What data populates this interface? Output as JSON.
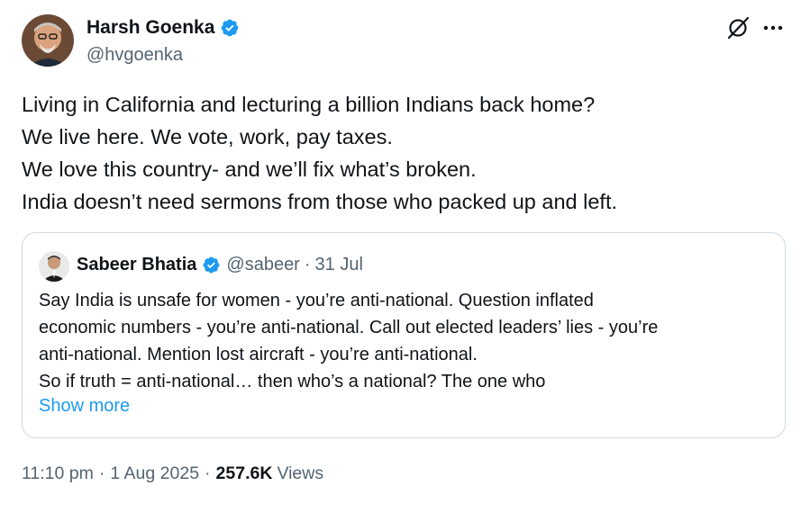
{
  "author": {
    "name": "Harsh Goenka",
    "handle": "@hvgoenka",
    "verified_color": "#1d9bf0"
  },
  "tweet": {
    "lines": [
      "Living in California and lecturing a billion Indians back home?",
      "We live here. We vote, work, pay taxes.",
      "We love this country- and we’ll fix what’s broken.",
      "India doesn’t need sermons from those who packed up and left."
    ]
  },
  "quoted": {
    "name": "Sabeer Bhatia",
    "handle": "@sabeer",
    "separator": "·",
    "date": "31 Jul",
    "lines": [
      "Say India is unsafe for women - you’re anti-national. Question inflated",
      "economic numbers - you’re anti-national. Call out elected leaders’ lies - you’re",
      "anti-national. Mention lost aircraft - you’re anti-national.",
      "So if truth = anti-national… then who’s a national? The one who"
    ],
    "show_more": "Show more"
  },
  "meta": {
    "time": "11:10 pm",
    "dot1": "·",
    "date": "1 Aug 2025",
    "dot2": "·",
    "views_count": "257.6K",
    "views_label": "Views"
  },
  "icons": {
    "grok": "grok-icon",
    "more": "more-icon",
    "verified": "verified-badge-icon"
  },
  "colors": {
    "accent": "#1d9bf0",
    "secondary_text": "#536471",
    "border": "#cfd9de"
  }
}
